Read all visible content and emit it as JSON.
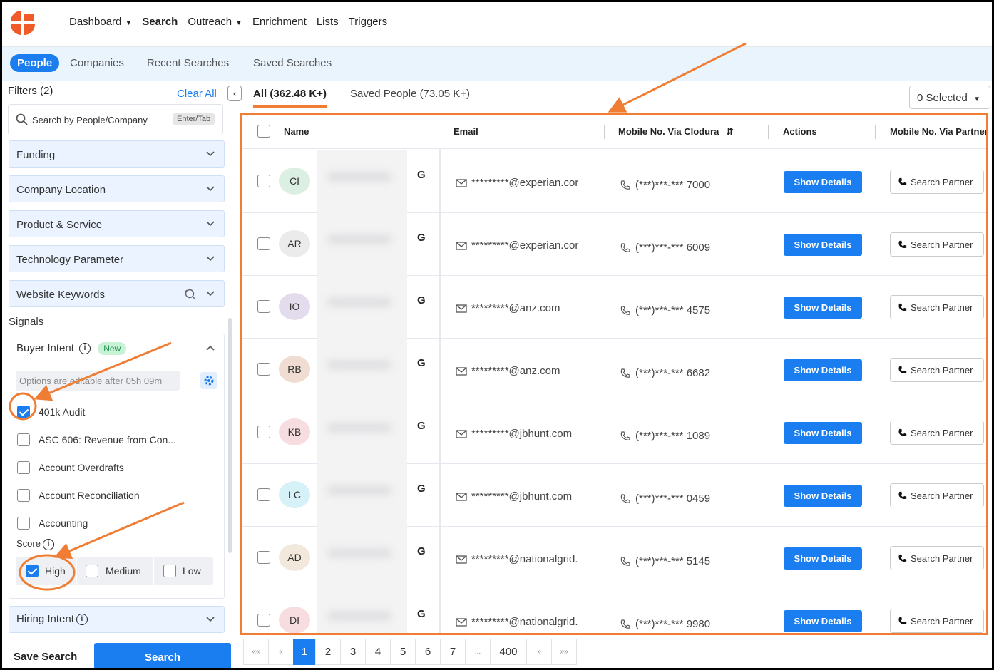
{
  "nav": {
    "items": [
      {
        "label": "Dashboard",
        "has_caret": true,
        "active": false
      },
      {
        "label": "Search",
        "has_caret": false,
        "active": true
      },
      {
        "label": "Outreach",
        "has_caret": true,
        "active": false
      },
      {
        "label": "Enrichment",
        "has_caret": false,
        "active": false
      },
      {
        "label": "Lists",
        "has_caret": false,
        "active": false
      },
      {
        "label": "Triggers",
        "has_caret": false,
        "active": false
      }
    ]
  },
  "tabs": [
    "People",
    "Companies",
    "Recent Searches",
    "Saved Searches"
  ],
  "sidebar": {
    "filters_title": "Filters (2)",
    "clear_all": "Clear All",
    "search_placeholder": "Search by People/Company",
    "search_hint": "Enter/Tab",
    "accordions": [
      "Funding",
      "Company Location",
      "Product & Service",
      "Technology Parameter",
      "Website Keywords"
    ],
    "signals_label": "Signals",
    "buyer_intent": {
      "title": "Buyer Intent",
      "badge": "New",
      "options_note": "Options are editable after 05h 09m",
      "options": [
        {
          "label": "401k Audit",
          "checked": true
        },
        {
          "label": "ASC 606: Revenue from Con...",
          "checked": false
        },
        {
          "label": "Account Overdrafts",
          "checked": false
        },
        {
          "label": "Account Reconciliation",
          "checked": false
        },
        {
          "label": "Accounting",
          "checked": false
        }
      ],
      "score_label": "Score",
      "scores": [
        {
          "label": "High",
          "checked": true
        },
        {
          "label": "Medium",
          "checked": false
        },
        {
          "label": "Low",
          "checked": false
        }
      ]
    },
    "hiring_intent": "Hiring Intent",
    "save_search": "Save Search",
    "search_button": "Search"
  },
  "subtabs": {
    "all": "All (362.48 K+)",
    "saved": "Saved People (73.05 K+)",
    "selected": "0 Selected"
  },
  "table": {
    "headers": [
      "Name",
      "Email",
      "Mobile No. Via Clodura",
      "Actions",
      "Mobile No. Via Partner"
    ],
    "show_details": "Show Details",
    "search_partner": "Search Partner",
    "rows": [
      {
        "initials": "CI",
        "avatar_color": "#dcefe3",
        "badge": "G",
        "email": "*********@experian.cor",
        "mobile": "(***)***-*** 7000"
      },
      {
        "initials": "AR",
        "avatar_color": "#ebebeb",
        "badge": "G",
        "email": "*********@experian.cor",
        "mobile": "(***)***-*** 6009"
      },
      {
        "initials": "IO",
        "avatar_color": "#e2dced",
        "badge": "G",
        "email": "*********@anz.com",
        "mobile": "(***)***-*** 4575"
      },
      {
        "initials": "RB",
        "avatar_color": "#f0dcd0",
        "badge": "G",
        "email": "*********@anz.com",
        "mobile": "(***)***-*** 6682"
      },
      {
        "initials": "KB",
        "avatar_color": "#f7dde0",
        "badge": "G",
        "email": "*********@jbhunt.com",
        "mobile": "(***)***-*** 1089"
      },
      {
        "initials": "LC",
        "avatar_color": "#d6f1f7",
        "badge": "G",
        "email": "*********@jbhunt.com",
        "mobile": "(***)***-*** 0459"
      },
      {
        "initials": "AD",
        "avatar_color": "#f3e8dc",
        "badge": "G",
        "email": "*********@nationalgrid.",
        "mobile": "(***)***-*** 5145"
      },
      {
        "initials": "DI",
        "avatar_color": "#f7dde0",
        "badge": "G",
        "email": "*********@nationalgrid.",
        "mobile": "(***)***-*** 9980"
      }
    ]
  },
  "pagination": [
    "««",
    "«",
    "1",
    "2",
    "3",
    "4",
    "5",
    "6",
    "7",
    "...",
    "400",
    "»",
    "»»"
  ],
  "pagination_active": "1",
  "colors": {
    "accent": "#1a7ef0",
    "highlight": "#f07d34",
    "logo": "#f05a28"
  }
}
